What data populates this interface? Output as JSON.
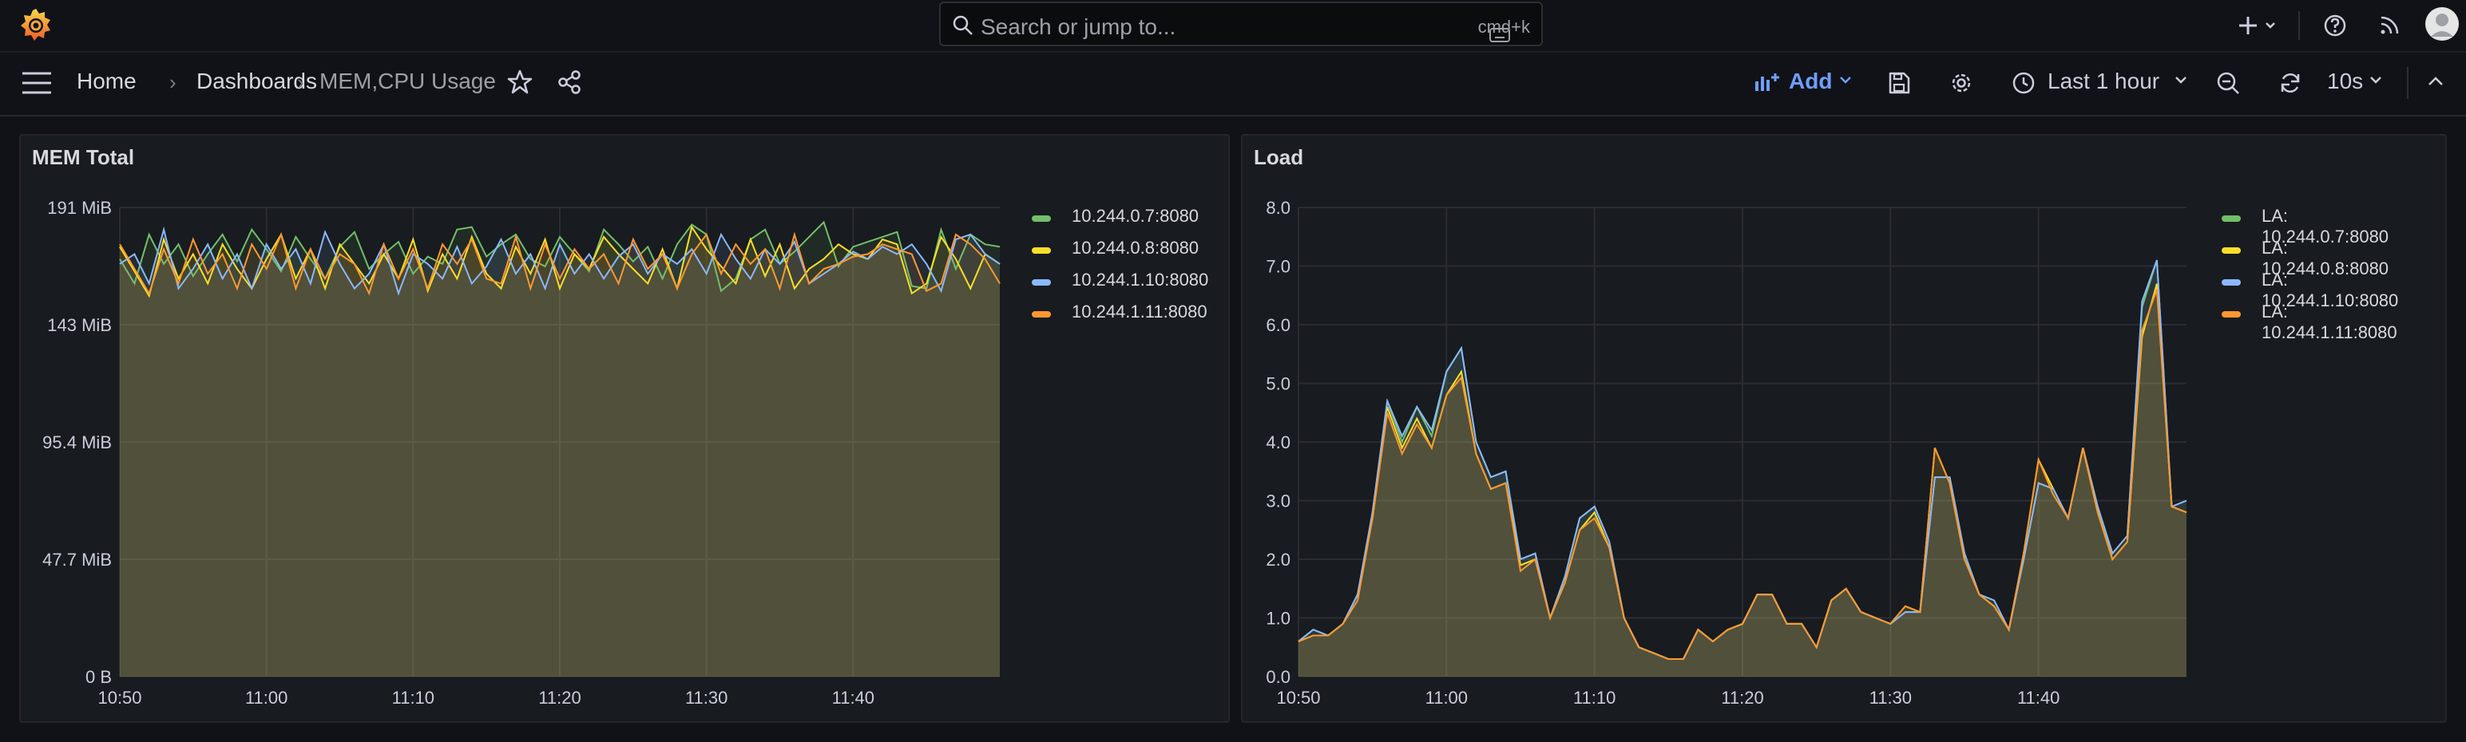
{
  "topbar": {
    "search_placeholder": "Search or jump to...",
    "search_shortcut": "cmd+k"
  },
  "breadcrumb": {
    "home": "Home",
    "dashboards": "Dashboards",
    "current": "MEM,CPU Usage"
  },
  "toolbar": {
    "add_label": "Add",
    "time_range": "Last 1 hour",
    "refresh_interval": "10s"
  },
  "colors": {
    "green": "#73bf69",
    "yellow": "#fade2a",
    "blue": "#8ab8ff",
    "orange": "#ff9830",
    "fill": "#4f4b3f"
  },
  "chart_data": [
    {
      "type": "line",
      "title": "MEM Total",
      "x_tick_labels": [
        "10:50",
        "11:00",
        "11:10",
        "11:20",
        "11:30",
        "11:40"
      ],
      "y_tick_labels": [
        "0 B",
        "47.7 MiB",
        "95.4 MiB",
        "143 MiB",
        "191 MiB"
      ],
      "ylim": [
        0,
        191
      ],
      "y_unit": "MiB",
      "x_range_minutes": [
        0,
        60
      ],
      "legend_placement": "right",
      "grid": true,
      "series": [
        {
          "name": "10.244.0.7:8080",
          "color": "#73bf69",
          "x": [
            0,
            1,
            2,
            3,
            4,
            5,
            6,
            7,
            8,
            9,
            10,
            11,
            12,
            13,
            14,
            15,
            16,
            17,
            18,
            19,
            20,
            21,
            22,
            23,
            24,
            25,
            26,
            27,
            28,
            29,
            30,
            31,
            32,
            33,
            34,
            35,
            36,
            37,
            38,
            39,
            40,
            41,
            42,
            43,
            44,
            45,
            46,
            47,
            48,
            49,
            50,
            51,
            52,
            53,
            54,
            55,
            56,
            57,
            58,
            59,
            60
          ],
          "y": [
            170,
            160,
            180,
            168,
            176,
            163,
            172,
            180,
            169,
            182,
            174,
            165,
            179,
            170,
            162,
            175,
            181,
            166,
            172,
            177,
            164,
            171,
            168,
            182,
            183,
            171,
            176,
            180,
            170,
            167,
            179,
            172,
            165,
            182,
            176,
            169,
            175,
            162,
            176,
            184,
            180,
            157,
            162,
            178,
            182,
            168,
            173,
            179,
            185,
            167,
            175,
            177,
            179,
            181,
            159,
            158,
            182,
            166,
            180,
            176,
            175
          ]
        },
        {
          "name": "10.244.0.8:8080",
          "color": "#fade2a",
          "x": [
            0,
            1,
            2,
            3,
            4,
            5,
            6,
            7,
            8,
            9,
            10,
            11,
            12,
            13,
            14,
            15,
            16,
            17,
            18,
            19,
            20,
            21,
            22,
            23,
            24,
            25,
            26,
            27,
            28,
            29,
            30,
            31,
            32,
            33,
            34,
            35,
            36,
            37,
            38,
            39,
            40,
            41,
            42,
            43,
            44,
            45,
            46,
            47,
            48,
            49,
            50,
            51,
            52,
            53,
            54,
            55,
            56,
            57,
            58,
            59,
            60
          ],
          "y": [
            175,
            165,
            155,
            178,
            162,
            172,
            160,
            176,
            166,
            158,
            170,
            180,
            162,
            174,
            158,
            176,
            168,
            160,
            172,
            162,
            178,
            157,
            172,
            162,
            179,
            164,
            158,
            175,
            164,
            178,
            158,
            172,
            166,
            179,
            172,
            166,
            160,
            174,
            158,
            183,
            174,
            167,
            160,
            178,
            163,
            176,
            158,
            166,
            170,
            176,
            172,
            170,
            178,
            176,
            156,
            160,
            179,
            170,
            158,
            172,
            168
          ]
        },
        {
          "name": "10.244.1.10:8080",
          "color": "#8ab8ff",
          "x": [
            0,
            1,
            2,
            3,
            4,
            5,
            6,
            7,
            8,
            9,
            10,
            11,
            12,
            13,
            14,
            15,
            16,
            17,
            18,
            19,
            20,
            21,
            22,
            23,
            24,
            25,
            26,
            27,
            28,
            29,
            30,
            31,
            32,
            33,
            34,
            35,
            36,
            37,
            38,
            39,
            40,
            41,
            42,
            43,
            44,
            45,
            46,
            47,
            48,
            49,
            50,
            51,
            52,
            53,
            54,
            55,
            56,
            57,
            58,
            59,
            60
          ],
          "y": [
            168,
            172,
            160,
            182,
            158,
            166,
            176,
            162,
            172,
            158,
            176,
            166,
            174,
            160,
            181,
            168,
            158,
            164,
            176,
            156,
            172,
            168,
            162,
            175,
            160,
            167,
            178,
            164,
            172,
            158,
            176,
            164,
            172,
            162,
            171,
            176,
            164,
            172,
            168,
            174,
            164,
            180,
            170,
            162,
            174,
            168,
            177,
            160,
            164,
            168,
            173,
            170,
            175,
            172,
            176,
            168,
            157,
            178,
            180,
            172,
            168
          ]
        },
        {
          "name": "10.244.1.11:8080",
          "color": "#ff9830",
          "x": [
            0,
            1,
            2,
            3,
            4,
            5,
            6,
            7,
            8,
            9,
            10,
            11,
            12,
            13,
            14,
            15,
            16,
            17,
            18,
            19,
            20,
            21,
            22,
            23,
            24,
            25,
            26,
            27,
            28,
            29,
            30,
            31,
            32,
            33,
            34,
            35,
            36,
            37,
            38,
            39,
            40,
            41,
            42,
            43,
            44,
            45,
            46,
            47,
            48,
            49,
            50,
            51,
            52,
            53,
            54,
            55,
            56,
            57,
            58,
            59,
            60
          ],
          "y": [
            176,
            166,
            156,
            174,
            160,
            178,
            164,
            172,
            158,
            176,
            166,
            180,
            158,
            174,
            162,
            172,
            168,
            156,
            176,
            162,
            174,
            158,
            176,
            168,
            178,
            162,
            160,
            179,
            158,
            176,
            162,
            174,
            166,
            172,
            160,
            178,
            166,
            172,
            158,
            172,
            180,
            164,
            176,
            168,
            174,
            158,
            180,
            160,
            166,
            168,
            171,
            172,
            176,
            174,
            172,
            157,
            160,
            180,
            176,
            170,
            160
          ]
        }
      ]
    },
    {
      "type": "line",
      "title": "Load",
      "x_tick_labels": [
        "10:50",
        "11:00",
        "11:10",
        "11:20",
        "11:30",
        "11:40"
      ],
      "y_tick_labels": [
        "0.0",
        "1.0",
        "2.0",
        "3.0",
        "4.0",
        "5.0",
        "6.0",
        "7.0",
        "8.0"
      ],
      "ylim": [
        0,
        8
      ],
      "x_range_minutes": [
        0,
        60
      ],
      "legend_placement": "right",
      "grid": true,
      "series": [
        {
          "name": "LA: 10.244.0.7:8080",
          "color": "#73bf69",
          "x": [
            0,
            1,
            2,
            3,
            4,
            5,
            6,
            7,
            8,
            9,
            10,
            11,
            12,
            13,
            14,
            15,
            16,
            17,
            18,
            19,
            20,
            21,
            22,
            23,
            24,
            25,
            26,
            27,
            28,
            29,
            30,
            31,
            32,
            33,
            34,
            35,
            36,
            37,
            38,
            39,
            40,
            41,
            42,
            43,
            44,
            45,
            46,
            47,
            48,
            49,
            50,
            51,
            52,
            53,
            54,
            55,
            56,
            57,
            58,
            59,
            60
          ],
          "y": [
            0.6,
            0.8,
            0.7,
            0.9,
            1.4,
            2.8,
            4.7,
            4.0,
            4.6,
            4.1,
            5.2,
            5.6,
            4.0,
            3.4,
            3.5,
            2.0,
            2.1,
            1.0,
            1.7,
            2.7,
            2.9,
            2.3,
            1.0,
            0.5,
            0.4,
            0.3,
            0.3,
            0.8,
            0.6,
            0.8,
            0.9,
            1.4,
            1.4,
            0.9,
            0.9,
            0.5,
            1.3,
            1.5,
            1.1,
            1.0,
            0.9,
            1.1,
            1.1,
            3.4,
            3.4,
            2.1,
            1.4,
            1.3,
            0.8,
            2.0,
            3.3,
            3.2,
            2.7,
            3.9,
            2.9,
            2.1,
            2.4,
            6.3,
            7.1,
            2.9,
            3.0
          ]
        },
        {
          "name": "LA: 10.244.0.8:8080",
          "color": "#fade2a",
          "x": [
            0,
            1,
            2,
            3,
            4,
            5,
            6,
            7,
            8,
            9,
            10,
            11,
            12,
            13,
            14,
            15,
            16,
            17,
            18,
            19,
            20,
            21,
            22,
            23,
            24,
            25,
            26,
            27,
            28,
            29,
            30,
            31,
            32,
            33,
            34,
            35,
            36,
            37,
            38,
            39,
            40,
            41,
            42,
            43,
            44,
            45,
            46,
            47,
            48,
            49,
            50,
            51,
            52,
            53,
            54,
            55,
            56,
            57,
            58,
            59,
            60
          ],
          "y": [
            0.6,
            0.7,
            0.7,
            0.9,
            1.4,
            2.7,
            4.6,
            3.9,
            4.4,
            3.9,
            4.8,
            5.2,
            3.8,
            3.2,
            3.3,
            1.9,
            2.0,
            1.0,
            1.6,
            2.5,
            2.8,
            2.2,
            1.0,
            0.5,
            0.4,
            0.3,
            0.3,
            0.8,
            0.6,
            0.8,
            0.9,
            1.4,
            1.4,
            0.9,
            0.9,
            0.5,
            1.3,
            1.5,
            1.1,
            1.0,
            0.9,
            1.2,
            1.1,
            3.9,
            3.3,
            2.0,
            1.4,
            1.2,
            0.8,
            2.1,
            3.7,
            3.2,
            2.7,
            3.9,
            2.8,
            2.0,
            2.3,
            5.8,
            6.7,
            2.9,
            2.8
          ]
        },
        {
          "name": "LA: 10.244.1.10:8080",
          "color": "#8ab8ff",
          "x": [
            0,
            1,
            2,
            3,
            4,
            5,
            6,
            7,
            8,
            9,
            10,
            11,
            12,
            13,
            14,
            15,
            16,
            17,
            18,
            19,
            20,
            21,
            22,
            23,
            24,
            25,
            26,
            27,
            28,
            29,
            30,
            31,
            32,
            33,
            34,
            35,
            36,
            37,
            38,
            39,
            40,
            41,
            42,
            43,
            44,
            45,
            46,
            47,
            48,
            49,
            50,
            51,
            52,
            53,
            54,
            55,
            56,
            57,
            58,
            59,
            60
          ],
          "y": [
            0.6,
            0.8,
            0.7,
            0.9,
            1.4,
            2.8,
            4.7,
            4.1,
            4.6,
            4.2,
            5.2,
            5.6,
            4.0,
            3.4,
            3.5,
            2.0,
            2.1,
            1.0,
            1.7,
            2.7,
            2.9,
            2.3,
            1.0,
            0.5,
            0.4,
            0.3,
            0.3,
            0.8,
            0.6,
            0.8,
            0.9,
            1.4,
            1.4,
            0.9,
            0.9,
            0.5,
            1.3,
            1.5,
            1.1,
            1.0,
            0.9,
            1.1,
            1.1,
            3.4,
            3.4,
            2.1,
            1.4,
            1.3,
            0.8,
            2.0,
            3.3,
            3.2,
            2.7,
            3.9,
            2.9,
            2.1,
            2.4,
            6.4,
            7.1,
            2.9,
            3.0
          ]
        },
        {
          "name": "LA: 10.244.1.11:8080",
          "color": "#ff9830",
          "x": [
            0,
            1,
            2,
            3,
            4,
            5,
            6,
            7,
            8,
            9,
            10,
            11,
            12,
            13,
            14,
            15,
            16,
            17,
            18,
            19,
            20,
            21,
            22,
            23,
            24,
            25,
            26,
            27,
            28,
            29,
            30,
            31,
            32,
            33,
            34,
            35,
            36,
            37,
            38,
            39,
            40,
            41,
            42,
            43,
            44,
            45,
            46,
            47,
            48,
            49,
            50,
            51,
            52,
            53,
            54,
            55,
            56,
            57,
            58,
            59,
            60
          ],
          "y": [
            0.6,
            0.7,
            0.7,
            0.9,
            1.3,
            2.7,
            4.5,
            3.8,
            4.3,
            3.9,
            4.8,
            5.1,
            3.8,
            3.2,
            3.3,
            1.8,
            2.0,
            1.0,
            1.6,
            2.5,
            2.7,
            2.2,
            1.0,
            0.5,
            0.4,
            0.3,
            0.3,
            0.8,
            0.6,
            0.8,
            0.9,
            1.4,
            1.4,
            0.9,
            0.9,
            0.5,
            1.3,
            1.5,
            1.1,
            1.0,
            0.9,
            1.2,
            1.1,
            3.9,
            3.3,
            2.0,
            1.4,
            1.2,
            0.8,
            2.1,
            3.7,
            3.1,
            2.7,
            3.9,
            2.8,
            2.0,
            2.3,
            5.9,
            6.6,
            2.9,
            2.8
          ]
        }
      ]
    }
  ]
}
